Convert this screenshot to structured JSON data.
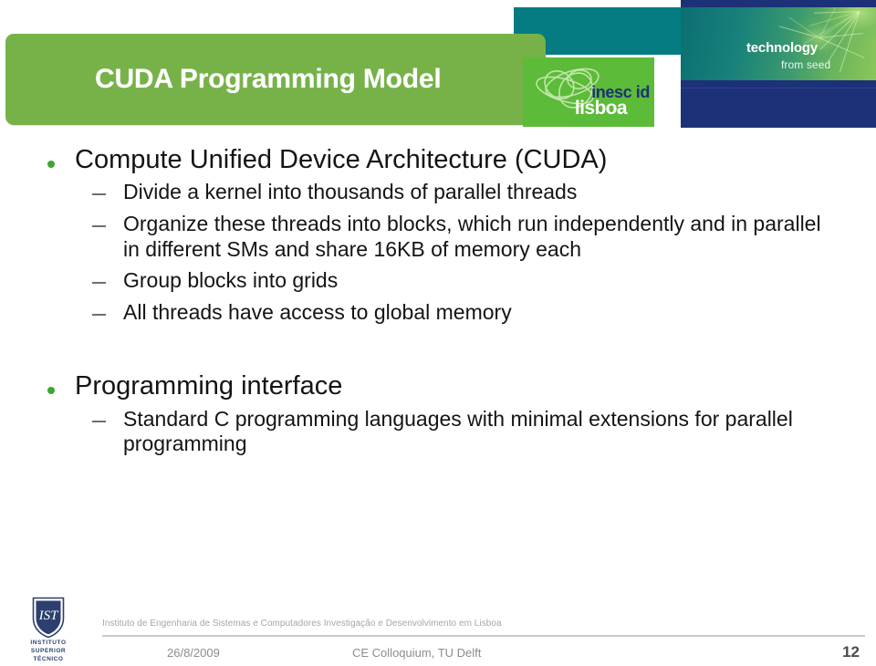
{
  "slide": {
    "title": "CUDA Programming Model",
    "branding": {
      "inesc_word": "inesc id",
      "inesc_lisboa": "lisboa",
      "tech_line1": "technology",
      "tech_line2": "from seed"
    },
    "colors": {
      "title_bar_green": "#76b248",
      "inesc_green": "#5cbb38",
      "teal": "#047c82",
      "navy": "#1d3178",
      "bullet_green": "#3aa733",
      "dash_gray": "#6e6e6e",
      "body_text": "#141414",
      "footer_gray": "#8d8d8d",
      "footer_tag_gray": "#a6a6a6"
    },
    "body": [
      {
        "level1": "Compute Unified Device Architecture (CUDA)",
        "level2": [
          "Divide a kernel into thousands of parallel threads",
          "Organize these threads into blocks, which run independently and in parallel in different SMs and share 16KB of memory each",
          "Group blocks into grids",
          "All threads have access to global memory"
        ]
      },
      {
        "level1": "Programming interface",
        "level2": [
          "Standard C programming languages with minimal extensions for parallel programming"
        ]
      }
    ],
    "footer": {
      "institute_tagline": "Instituto de Engenharia de Sistemas e Computadores Investigação e Desenvolvimento em Lisboa",
      "ist_caption_line1": "INSTITUTO",
      "ist_caption_line2": "SUPERIOR",
      "ist_caption_line3": "TÉCNICO",
      "date": "26/8/2009",
      "event": "CE Colloquium, TU Delft",
      "page_number": "12"
    }
  }
}
